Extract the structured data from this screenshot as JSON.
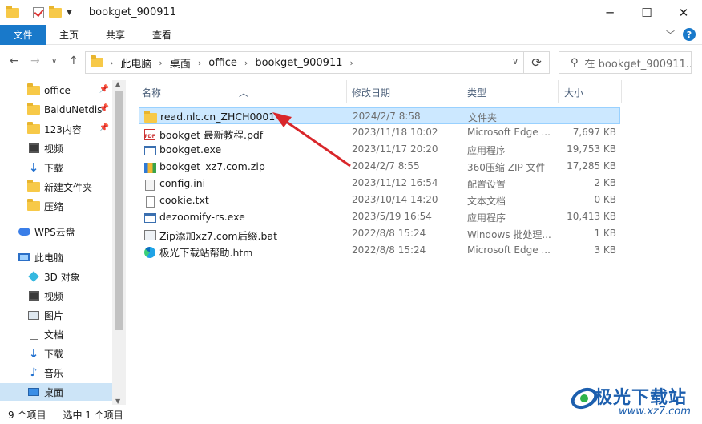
{
  "window": {
    "title": "bookget_900911"
  },
  "ribbon": {
    "tabs": [
      "文件",
      "主页",
      "共享",
      "查看"
    ],
    "help": "?"
  },
  "address": {
    "crumbs": [
      "此电脑",
      "桌面",
      "office",
      "bookget_900911"
    ],
    "search_placeholder": "在 bookget_900911..."
  },
  "sidebar": {
    "items": [
      {
        "label": "office",
        "icon": "folder-icon",
        "pinned": true
      },
      {
        "label": "BaiduNetdis",
        "icon": "folder-icon",
        "pinned": true
      },
      {
        "label": "123内容",
        "icon": "folder-icon",
        "pinned": true
      },
      {
        "label": "视频",
        "icon": "video-icon"
      },
      {
        "label": "下载",
        "icon": "download-icon"
      },
      {
        "label": "新建文件夹",
        "icon": "folder-icon"
      },
      {
        "label": "压缩",
        "icon": "folder-icon"
      },
      {
        "label": "WPS云盘",
        "icon": "cloud-icon"
      },
      {
        "label": "此电脑",
        "icon": "computer-icon"
      },
      {
        "label": "3D 对象",
        "icon": "3d-objects-icon"
      },
      {
        "label": "视频",
        "icon": "video-icon"
      },
      {
        "label": "图片",
        "icon": "pictures-icon"
      },
      {
        "label": "文档",
        "icon": "documents-icon"
      },
      {
        "label": "下载",
        "icon": "download-icon"
      },
      {
        "label": "音乐",
        "icon": "music-icon"
      },
      {
        "label": "桌面",
        "icon": "desktop-icon",
        "active": true
      }
    ]
  },
  "columns": {
    "name": "名称",
    "date": "修改日期",
    "type": "类型",
    "size": "大小"
  },
  "files": [
    {
      "name": "read.nlc.cn_ZHCH0001",
      "date": "2024/2/7 8:58",
      "type": "文件夹",
      "size": "",
      "icon": "folder-icon",
      "selected": true
    },
    {
      "name": "bookget 最新教程.pdf",
      "date": "2023/11/18 10:02",
      "type": "Microsoft Edge ...",
      "size": "7,697 KB",
      "icon": "pdf-icon"
    },
    {
      "name": "bookget.exe",
      "date": "2023/11/17 20:20",
      "type": "应用程序",
      "size": "19,753 KB",
      "icon": "exe-icon"
    },
    {
      "name": "bookget_xz7.com.zip",
      "date": "2024/2/7 8:55",
      "type": "360压缩 ZIP 文件",
      "size": "17,285 KB",
      "icon": "zip-icon"
    },
    {
      "name": "config.ini",
      "date": "2023/11/12 16:54",
      "type": "配置设置",
      "size": "2 KB",
      "icon": "ini-icon"
    },
    {
      "name": "cookie.txt",
      "date": "2023/10/14 14:20",
      "type": "文本文档",
      "size": "0 KB",
      "icon": "txt-icon"
    },
    {
      "name": "dezoomify-rs.exe",
      "date": "2023/5/19 16:54",
      "type": "应用程序",
      "size": "10,413 KB",
      "icon": "exe-icon"
    },
    {
      "name": "Zip添加xz7.com后缀.bat",
      "date": "2022/8/8 15:24",
      "type": "Windows 批处理...",
      "size": "1 KB",
      "icon": "bat-icon"
    },
    {
      "name": "极光下载站帮助.htm",
      "date": "2022/8/8 15:24",
      "type": "Microsoft Edge ...",
      "size": "3 KB",
      "icon": "edge-icon"
    }
  ],
  "status": {
    "count": "9 个项目",
    "selected": "选中 1 个项目"
  },
  "watermark": {
    "text": "极光下载站",
    "url": "www.xz7.com"
  },
  "colors": {
    "accent": "#1979ca",
    "selection": "#cce8ff",
    "annotation_arrow": "#d9262a"
  }
}
